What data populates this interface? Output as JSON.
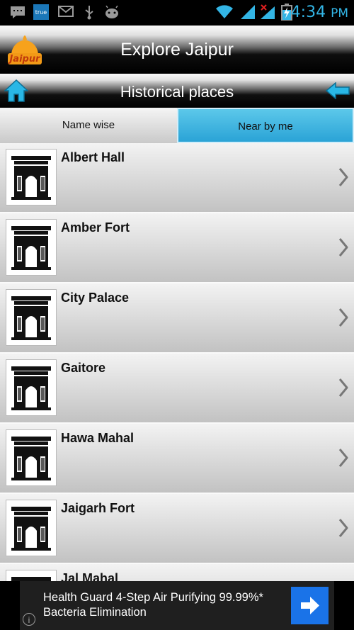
{
  "status_bar": {
    "time": "4:34",
    "ampm": "PM",
    "carrier_badge": "true",
    "icons": [
      "message-icon",
      "carrier-badge-icon",
      "gmail-icon",
      "usb-icon",
      "android-debug-icon",
      "wifi-icon",
      "signal-icon",
      "signal-nodata-icon",
      "battery-charging-icon"
    ]
  },
  "app_bar": {
    "title": "Explore Jaipur",
    "logo_text": "Jaipur"
  },
  "sub_header": {
    "title": "Historical places",
    "home_icon": "home-icon",
    "back_icon": "back-arrow-icon"
  },
  "tabs": [
    {
      "label": "Name wise",
      "selected": false
    },
    {
      "label": "Near by me",
      "selected": true
    }
  ],
  "places": [
    {
      "name": "Albert Hall"
    },
    {
      "name": "Amber Fort"
    },
    {
      "name": "City Palace"
    },
    {
      "name": "Gaitore"
    },
    {
      "name": "Hawa Mahal"
    },
    {
      "name": "Jaigarh Fort"
    },
    {
      "name": "Jal Mahal"
    }
  ],
  "ad": {
    "text": "Health Guard 4-Step Air Purifying 99.99%* Bacteria Elimination",
    "info": "i",
    "button_icon": "arrow-right-icon"
  },
  "colors": {
    "accent": "#33b5e5",
    "tab_selected": "#2aa3d6",
    "ad_button": "#1a73e8"
  }
}
